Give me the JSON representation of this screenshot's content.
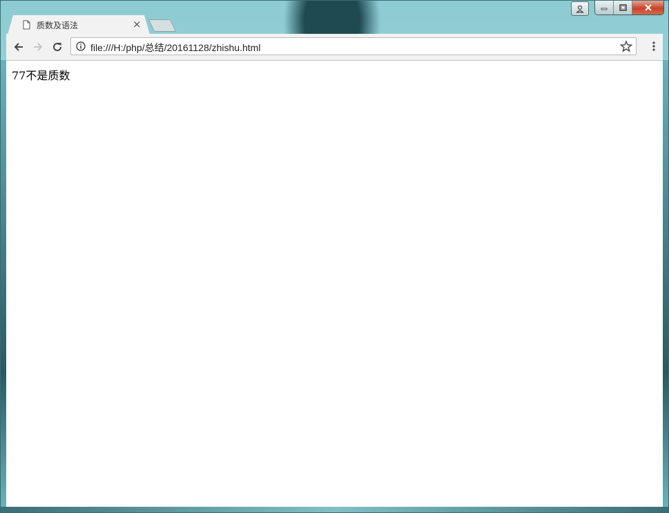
{
  "tab": {
    "title": "质数及语法",
    "close_glyph": "×"
  },
  "toolbar": {
    "url": "file:///H:/php/总结/20161128/zhishu.html"
  },
  "page": {
    "text": "77不是质数"
  }
}
